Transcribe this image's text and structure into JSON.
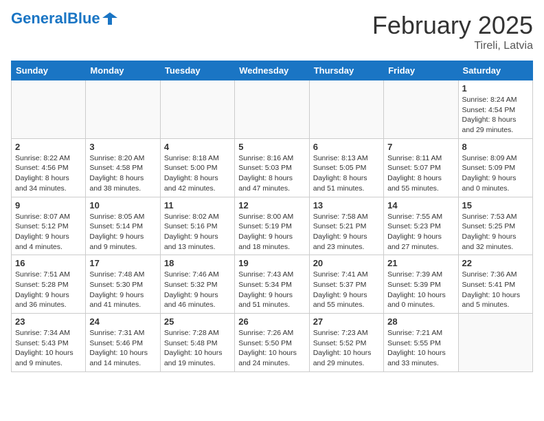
{
  "header": {
    "logo_general": "General",
    "logo_blue": "Blue",
    "month_title": "February 2025",
    "location": "Tireli, Latvia"
  },
  "weekdays": [
    "Sunday",
    "Monday",
    "Tuesday",
    "Wednesday",
    "Thursday",
    "Friday",
    "Saturday"
  ],
  "weeks": [
    [
      {
        "day": "",
        "info": ""
      },
      {
        "day": "",
        "info": ""
      },
      {
        "day": "",
        "info": ""
      },
      {
        "day": "",
        "info": ""
      },
      {
        "day": "",
        "info": ""
      },
      {
        "day": "",
        "info": ""
      },
      {
        "day": "1",
        "info": "Sunrise: 8:24 AM\nSunset: 4:54 PM\nDaylight: 8 hours and 29 minutes."
      }
    ],
    [
      {
        "day": "2",
        "info": "Sunrise: 8:22 AM\nSunset: 4:56 PM\nDaylight: 8 hours and 34 minutes."
      },
      {
        "day": "3",
        "info": "Sunrise: 8:20 AM\nSunset: 4:58 PM\nDaylight: 8 hours and 38 minutes."
      },
      {
        "day": "4",
        "info": "Sunrise: 8:18 AM\nSunset: 5:00 PM\nDaylight: 8 hours and 42 minutes."
      },
      {
        "day": "5",
        "info": "Sunrise: 8:16 AM\nSunset: 5:03 PM\nDaylight: 8 hours and 47 minutes."
      },
      {
        "day": "6",
        "info": "Sunrise: 8:13 AM\nSunset: 5:05 PM\nDaylight: 8 hours and 51 minutes."
      },
      {
        "day": "7",
        "info": "Sunrise: 8:11 AM\nSunset: 5:07 PM\nDaylight: 8 hours and 55 minutes."
      },
      {
        "day": "8",
        "info": "Sunrise: 8:09 AM\nSunset: 5:09 PM\nDaylight: 9 hours and 0 minutes."
      }
    ],
    [
      {
        "day": "9",
        "info": "Sunrise: 8:07 AM\nSunset: 5:12 PM\nDaylight: 9 hours and 4 minutes."
      },
      {
        "day": "10",
        "info": "Sunrise: 8:05 AM\nSunset: 5:14 PM\nDaylight: 9 hours and 9 minutes."
      },
      {
        "day": "11",
        "info": "Sunrise: 8:02 AM\nSunset: 5:16 PM\nDaylight: 9 hours and 13 minutes."
      },
      {
        "day": "12",
        "info": "Sunrise: 8:00 AM\nSunset: 5:19 PM\nDaylight: 9 hours and 18 minutes."
      },
      {
        "day": "13",
        "info": "Sunrise: 7:58 AM\nSunset: 5:21 PM\nDaylight: 9 hours and 23 minutes."
      },
      {
        "day": "14",
        "info": "Sunrise: 7:55 AM\nSunset: 5:23 PM\nDaylight: 9 hours and 27 minutes."
      },
      {
        "day": "15",
        "info": "Sunrise: 7:53 AM\nSunset: 5:25 PM\nDaylight: 9 hours and 32 minutes."
      }
    ],
    [
      {
        "day": "16",
        "info": "Sunrise: 7:51 AM\nSunset: 5:28 PM\nDaylight: 9 hours and 36 minutes."
      },
      {
        "day": "17",
        "info": "Sunrise: 7:48 AM\nSunset: 5:30 PM\nDaylight: 9 hours and 41 minutes."
      },
      {
        "day": "18",
        "info": "Sunrise: 7:46 AM\nSunset: 5:32 PM\nDaylight: 9 hours and 46 minutes."
      },
      {
        "day": "19",
        "info": "Sunrise: 7:43 AM\nSunset: 5:34 PM\nDaylight: 9 hours and 51 minutes."
      },
      {
        "day": "20",
        "info": "Sunrise: 7:41 AM\nSunset: 5:37 PM\nDaylight: 9 hours and 55 minutes."
      },
      {
        "day": "21",
        "info": "Sunrise: 7:39 AM\nSunset: 5:39 PM\nDaylight: 10 hours and 0 minutes."
      },
      {
        "day": "22",
        "info": "Sunrise: 7:36 AM\nSunset: 5:41 PM\nDaylight: 10 hours and 5 minutes."
      }
    ],
    [
      {
        "day": "23",
        "info": "Sunrise: 7:34 AM\nSunset: 5:43 PM\nDaylight: 10 hours and 9 minutes."
      },
      {
        "day": "24",
        "info": "Sunrise: 7:31 AM\nSunset: 5:46 PM\nDaylight: 10 hours and 14 minutes."
      },
      {
        "day": "25",
        "info": "Sunrise: 7:28 AM\nSunset: 5:48 PM\nDaylight: 10 hours and 19 minutes."
      },
      {
        "day": "26",
        "info": "Sunrise: 7:26 AM\nSunset: 5:50 PM\nDaylight: 10 hours and 24 minutes."
      },
      {
        "day": "27",
        "info": "Sunrise: 7:23 AM\nSunset: 5:52 PM\nDaylight: 10 hours and 29 minutes."
      },
      {
        "day": "28",
        "info": "Sunrise: 7:21 AM\nSunset: 5:55 PM\nDaylight: 10 hours and 33 minutes."
      },
      {
        "day": "",
        "info": ""
      }
    ]
  ]
}
